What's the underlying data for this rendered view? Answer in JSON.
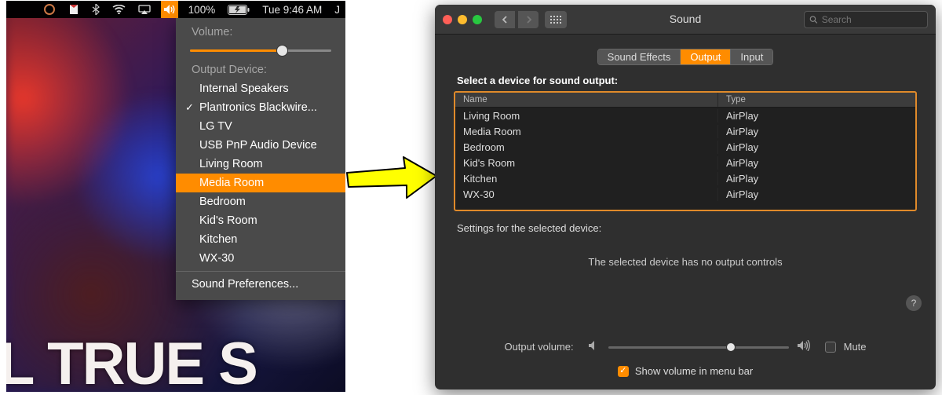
{
  "accent": "#ff8c00",
  "menubar": {
    "battery_text": "100%",
    "clock_text": "Tue 9:46 AM"
  },
  "dropdown": {
    "volume_label": "Volume:",
    "volume_percent": 65,
    "output_label": "Output Device:",
    "items": [
      {
        "label": "Internal Speakers",
        "checked": false,
        "selected": false
      },
      {
        "label": "Plantronics Blackwire...",
        "checked": true,
        "selected": false
      },
      {
        "label": "LG TV",
        "checked": false,
        "selected": false
      },
      {
        "label": "USB PnP Audio Device",
        "checked": false,
        "selected": false
      },
      {
        "label": "Living Room",
        "checked": false,
        "selected": false
      },
      {
        "label": "Media Room",
        "checked": false,
        "selected": true
      },
      {
        "label": "Bedroom",
        "checked": false,
        "selected": false
      },
      {
        "label": "Kid's Room",
        "checked": false,
        "selected": false
      },
      {
        "label": "Kitchen",
        "checked": false,
        "selected": false
      },
      {
        "label": "WX-30",
        "checked": false,
        "selected": false
      }
    ],
    "prefs_label": "Sound Preferences..."
  },
  "bg_big_text": "L TRUE S",
  "window": {
    "title": "Sound",
    "search_placeholder": "Search",
    "tabs": [
      {
        "label": "Sound Effects",
        "active": false
      },
      {
        "label": "Output",
        "active": true
      },
      {
        "label": "Input",
        "active": false
      }
    ],
    "select_label": "Select a device for sound output:",
    "columns": {
      "name": "Name",
      "type": "Type"
    },
    "devices": [
      {
        "name": "Living Room",
        "type": "AirPlay"
      },
      {
        "name": "Media Room",
        "type": "AirPlay"
      },
      {
        "name": "Bedroom",
        "type": "AirPlay"
      },
      {
        "name": "Kid's Room",
        "type": "AirPlay"
      },
      {
        "name": "Kitchen",
        "type": "AirPlay"
      },
      {
        "name": "WX-30",
        "type": "AirPlay"
      }
    ],
    "settings_label": "Settings for the selected device:",
    "no_controls": "The selected device has no output controls",
    "output_volume_label": "Output volume:",
    "output_volume_percent": 68,
    "mute_label": "Mute",
    "show_volume_label": "Show volume in menu bar",
    "show_volume_checked": true
  }
}
